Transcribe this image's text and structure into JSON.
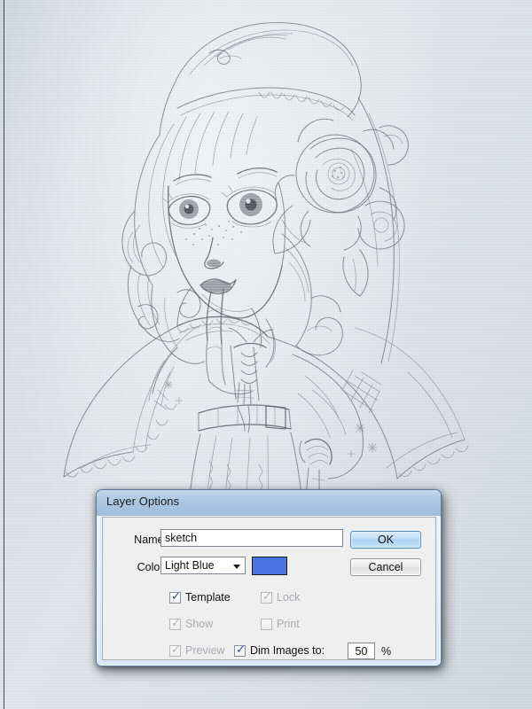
{
  "canvas": {
    "artwork_description": "pencil sketch of a girl wearing a bonnet with flowers, hand to mouth"
  },
  "dialog": {
    "title": "Layer Options",
    "fields": {
      "name_label": "Name:",
      "name_value": "sketch",
      "color_label": "Color:",
      "color_value": "Light Blue",
      "color_swatch_hex": "#4a73e2",
      "dropdown_icon": "chevron-down-icon"
    },
    "checkboxes": [
      {
        "id": "template",
        "label": "Template",
        "checked": true,
        "disabled": false
      },
      {
        "id": "lock",
        "label": "Lock",
        "checked": true,
        "disabled": true
      },
      {
        "id": "show",
        "label": "Show",
        "checked": true,
        "disabled": true
      },
      {
        "id": "print",
        "label": "Print",
        "checked": false,
        "disabled": true
      },
      {
        "id": "preview",
        "label": "Preview",
        "checked": true,
        "disabled": true
      },
      {
        "id": "dim",
        "label": "Dim Images to:",
        "checked": true,
        "disabled": false
      }
    ],
    "dim": {
      "value": "50",
      "unit": "%"
    },
    "buttons": {
      "ok": "OK",
      "cancel": "Cancel"
    },
    "check_glyph": "✓"
  }
}
